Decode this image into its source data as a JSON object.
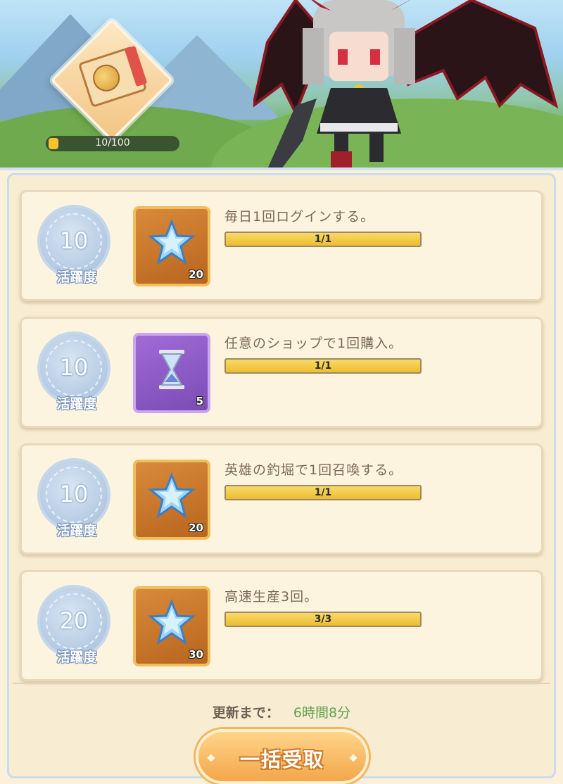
{
  "top_reward": {
    "progress_text": "10/100",
    "progress_fraction": 0.1
  },
  "tasks": [
    {
      "points": "10",
      "points_label": "活躍度",
      "item": "blue-star-icon",
      "item_frame": "orange",
      "quantity": "20",
      "description": "毎日1回ログインする。",
      "progress_text": "1/1",
      "progress_fraction": 1.0
    },
    {
      "points": "10",
      "points_label": "活躍度",
      "item": "hourglass-icon",
      "item_frame": "purple",
      "quantity": "5",
      "description": "任意のショップで1回購入。",
      "progress_text": "1/1",
      "progress_fraction": 1.0
    },
    {
      "points": "10",
      "points_label": "活躍度",
      "item": "blue-star-icon",
      "item_frame": "orange",
      "quantity": "20",
      "description": "英雄の釣堀で1回召喚する。",
      "progress_text": "1/1",
      "progress_fraction": 1.0
    },
    {
      "points": "20",
      "points_label": "活躍度",
      "item": "blue-star-icon",
      "item_frame": "orange",
      "quantity": "30",
      "description": "高速生産3回。",
      "progress_text": "3/3",
      "progress_fraction": 1.0
    }
  ],
  "refresh": {
    "label": "更新まで：",
    "value": "6時間8分"
  },
  "claim_all_button": "一括受取",
  "colors": {
    "progress_yellow": "#f0c94a",
    "timer_green": "#5fa24b",
    "button_orange": "#f3a64a"
  }
}
